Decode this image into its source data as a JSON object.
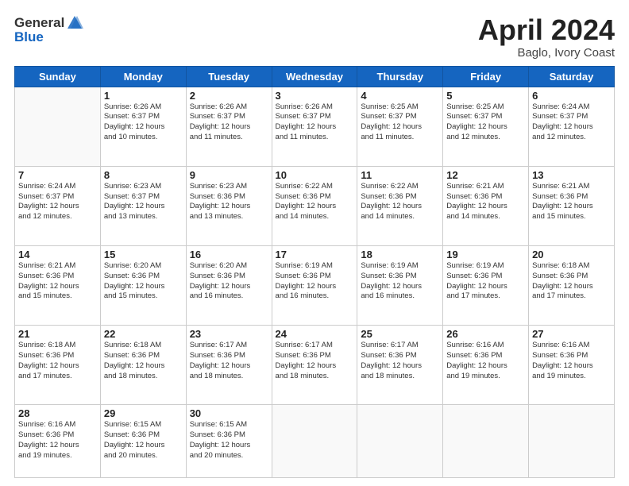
{
  "header": {
    "logo_general": "General",
    "logo_blue": "Blue",
    "month_title": "April 2024",
    "location": "Baglo, Ivory Coast"
  },
  "weekdays": [
    "Sunday",
    "Monday",
    "Tuesday",
    "Wednesday",
    "Thursday",
    "Friday",
    "Saturday"
  ],
  "weeks": [
    [
      {
        "day": "",
        "info": ""
      },
      {
        "day": "1",
        "info": "Sunrise: 6:26 AM\nSunset: 6:37 PM\nDaylight: 12 hours\nand 10 minutes."
      },
      {
        "day": "2",
        "info": "Sunrise: 6:26 AM\nSunset: 6:37 PM\nDaylight: 12 hours\nand 11 minutes."
      },
      {
        "day": "3",
        "info": "Sunrise: 6:26 AM\nSunset: 6:37 PM\nDaylight: 12 hours\nand 11 minutes."
      },
      {
        "day": "4",
        "info": "Sunrise: 6:25 AM\nSunset: 6:37 PM\nDaylight: 12 hours\nand 11 minutes."
      },
      {
        "day": "5",
        "info": "Sunrise: 6:25 AM\nSunset: 6:37 PM\nDaylight: 12 hours\nand 12 minutes."
      },
      {
        "day": "6",
        "info": "Sunrise: 6:24 AM\nSunset: 6:37 PM\nDaylight: 12 hours\nand 12 minutes."
      }
    ],
    [
      {
        "day": "7",
        "info": "Sunrise: 6:24 AM\nSunset: 6:37 PM\nDaylight: 12 hours\nand 12 minutes."
      },
      {
        "day": "8",
        "info": "Sunrise: 6:23 AM\nSunset: 6:37 PM\nDaylight: 12 hours\nand 13 minutes."
      },
      {
        "day": "9",
        "info": "Sunrise: 6:23 AM\nSunset: 6:36 PM\nDaylight: 12 hours\nand 13 minutes."
      },
      {
        "day": "10",
        "info": "Sunrise: 6:22 AM\nSunset: 6:36 PM\nDaylight: 12 hours\nand 14 minutes."
      },
      {
        "day": "11",
        "info": "Sunrise: 6:22 AM\nSunset: 6:36 PM\nDaylight: 12 hours\nand 14 minutes."
      },
      {
        "day": "12",
        "info": "Sunrise: 6:21 AM\nSunset: 6:36 PM\nDaylight: 12 hours\nand 14 minutes."
      },
      {
        "day": "13",
        "info": "Sunrise: 6:21 AM\nSunset: 6:36 PM\nDaylight: 12 hours\nand 15 minutes."
      }
    ],
    [
      {
        "day": "14",
        "info": "Sunrise: 6:21 AM\nSunset: 6:36 PM\nDaylight: 12 hours\nand 15 minutes."
      },
      {
        "day": "15",
        "info": "Sunrise: 6:20 AM\nSunset: 6:36 PM\nDaylight: 12 hours\nand 15 minutes."
      },
      {
        "day": "16",
        "info": "Sunrise: 6:20 AM\nSunset: 6:36 PM\nDaylight: 12 hours\nand 16 minutes."
      },
      {
        "day": "17",
        "info": "Sunrise: 6:19 AM\nSunset: 6:36 PM\nDaylight: 12 hours\nand 16 minutes."
      },
      {
        "day": "18",
        "info": "Sunrise: 6:19 AM\nSunset: 6:36 PM\nDaylight: 12 hours\nand 16 minutes."
      },
      {
        "day": "19",
        "info": "Sunrise: 6:19 AM\nSunset: 6:36 PM\nDaylight: 12 hours\nand 17 minutes."
      },
      {
        "day": "20",
        "info": "Sunrise: 6:18 AM\nSunset: 6:36 PM\nDaylight: 12 hours\nand 17 minutes."
      }
    ],
    [
      {
        "day": "21",
        "info": "Sunrise: 6:18 AM\nSunset: 6:36 PM\nDaylight: 12 hours\nand 17 minutes."
      },
      {
        "day": "22",
        "info": "Sunrise: 6:18 AM\nSunset: 6:36 PM\nDaylight: 12 hours\nand 18 minutes."
      },
      {
        "day": "23",
        "info": "Sunrise: 6:17 AM\nSunset: 6:36 PM\nDaylight: 12 hours\nand 18 minutes."
      },
      {
        "day": "24",
        "info": "Sunrise: 6:17 AM\nSunset: 6:36 PM\nDaylight: 12 hours\nand 18 minutes."
      },
      {
        "day": "25",
        "info": "Sunrise: 6:17 AM\nSunset: 6:36 PM\nDaylight: 12 hours\nand 18 minutes."
      },
      {
        "day": "26",
        "info": "Sunrise: 6:16 AM\nSunset: 6:36 PM\nDaylight: 12 hours\nand 19 minutes."
      },
      {
        "day": "27",
        "info": "Sunrise: 6:16 AM\nSunset: 6:36 PM\nDaylight: 12 hours\nand 19 minutes."
      }
    ],
    [
      {
        "day": "28",
        "info": "Sunrise: 6:16 AM\nSunset: 6:36 PM\nDaylight: 12 hours\nand 19 minutes."
      },
      {
        "day": "29",
        "info": "Sunrise: 6:15 AM\nSunset: 6:36 PM\nDaylight: 12 hours\nand 20 minutes."
      },
      {
        "day": "30",
        "info": "Sunrise: 6:15 AM\nSunset: 6:36 PM\nDaylight: 12 hours\nand 20 minutes."
      },
      {
        "day": "",
        "info": ""
      },
      {
        "day": "",
        "info": ""
      },
      {
        "day": "",
        "info": ""
      },
      {
        "day": "",
        "info": ""
      }
    ]
  ]
}
